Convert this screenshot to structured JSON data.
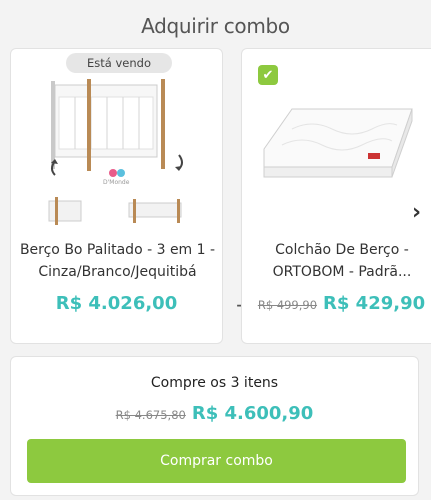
{
  "title": "Adquirir combo",
  "products": [
    {
      "badge": "Está vendo",
      "name": "Berço Bo Palitado - 3 em 1 - Cinza/Branco/Jequitibá",
      "price": "R$ 4.026,00",
      "image_caption": "D'Monde"
    },
    {
      "check_icon": "✔",
      "name": "Colchão De Berço - ORTOBOM - Padrã...",
      "old_price": "R$ 499,90",
      "price": "R$ 429,90"
    }
  ],
  "plus": "+",
  "next_arrow": "›",
  "summary": {
    "title": "Compre os 3 itens",
    "old_price": "R$ 4.675,80",
    "price": "R$ 4.600,90",
    "button": "Comprar combo"
  },
  "colors": {
    "accent_price": "#3dbfb9",
    "button": "#8dc93f"
  }
}
